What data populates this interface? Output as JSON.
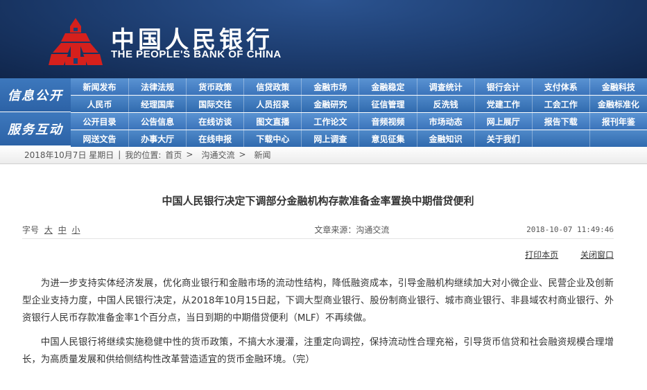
{
  "header": {
    "title_cn": "中国人民银行",
    "title_en": "THE PEOPLE'S BANK OF CHINA"
  },
  "nav": {
    "section1": "信息公开",
    "section2": "服务互动",
    "rows": [
      [
        "新闻发布",
        "法律法规",
        "货币政策",
        "信贷政策",
        "金融市场",
        "金融稳定",
        "调查统计",
        "银行会计",
        "支付体系",
        "金融科技"
      ],
      [
        "人民币",
        "经理国库",
        "国际交往",
        "人员招录",
        "金融研究",
        "征信管理",
        "反洗钱",
        "党建工作",
        "工会工作",
        "金融标准化"
      ],
      [
        "公开目录",
        "公告信息",
        "在线访谈",
        "图文直播",
        "工作论文",
        "音频视频",
        "市场动态",
        "网上展厅",
        "报告下载",
        "报刊年鉴"
      ],
      [
        "网送文告",
        "办事大厅",
        "在线申报",
        "下载中心",
        "网上调查",
        "意见征集",
        "金融知识",
        "关于我们",
        "",
        ""
      ]
    ]
  },
  "breadcrumb": {
    "date": "2018年10月7日 星期日",
    "location_label": "我的位置:",
    "home": "首页",
    "level1": "沟通交流",
    "level2": "新闻"
  },
  "article": {
    "title": "中国人民银行决定下调部分金融机构存款准备金率置换中期借贷便利",
    "font_label": "字号",
    "font_large": "大",
    "font_medium": "中",
    "font_small": "小",
    "source": "文章来源：沟通交流",
    "datetime": "2018-10-07 11:49:46",
    "print_label": "打印本页",
    "close_label": "关闭窗口",
    "paragraphs": [
      "为进一步支持实体经济发展，优化商业银行和金融市场的流动性结构，降低融资成本，引导金融机构继续加大对小微企业、民营企业及创新型企业支持力度，中国人民银行决定，从2018年10月15日起，下调大型商业银行、股份制商业银行、城市商业银行、非县域农村商业银行、外资银行人民币存款准备金率1个百分点，当日到期的中期借贷便利（MLF）不再续做。",
      "中国人民银行将继续实施稳健中性的货币政策，不搞大水漫灌，注重定向调控，保持流动性合理充裕，引导货币信贷和社会融资规模合理增长，为高质量发展和供给侧结构性改革营造适宜的货币金融环境。（完）"
    ]
  },
  "colors": {
    "banner": "#1e3f73",
    "nav": "#3b74bb",
    "logo": "#d6201c"
  }
}
